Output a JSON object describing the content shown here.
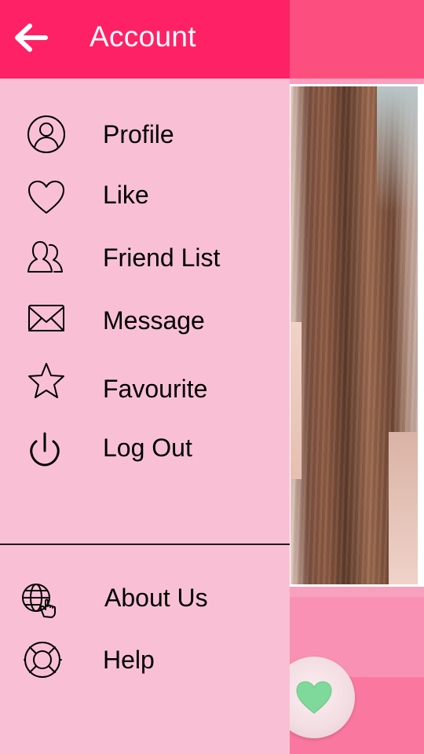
{
  "header": {
    "title": "Account"
  },
  "menu": {
    "primary": [
      {
        "label": "Profile",
        "icon": "profile-icon"
      },
      {
        "label": "Like",
        "icon": "heart-outline-icon"
      },
      {
        "label": "Friend List",
        "icon": "friends-icon"
      },
      {
        "label": "Message",
        "icon": "envelope-icon"
      },
      {
        "label": "Favourite",
        "icon": "star-icon"
      },
      {
        "label": "Log Out",
        "icon": "power-icon"
      }
    ],
    "secondary": [
      {
        "label": "About Us",
        "icon": "globe-hand-icon"
      },
      {
        "label": "Help",
        "icon": "lifebuoy-icon"
      }
    ]
  },
  "colors": {
    "header_bg": "#ff2166",
    "drawer_bg": "#f9c0d5",
    "app_topbar": "#fd4f7f",
    "heart_fill": "#7fd99a"
  }
}
